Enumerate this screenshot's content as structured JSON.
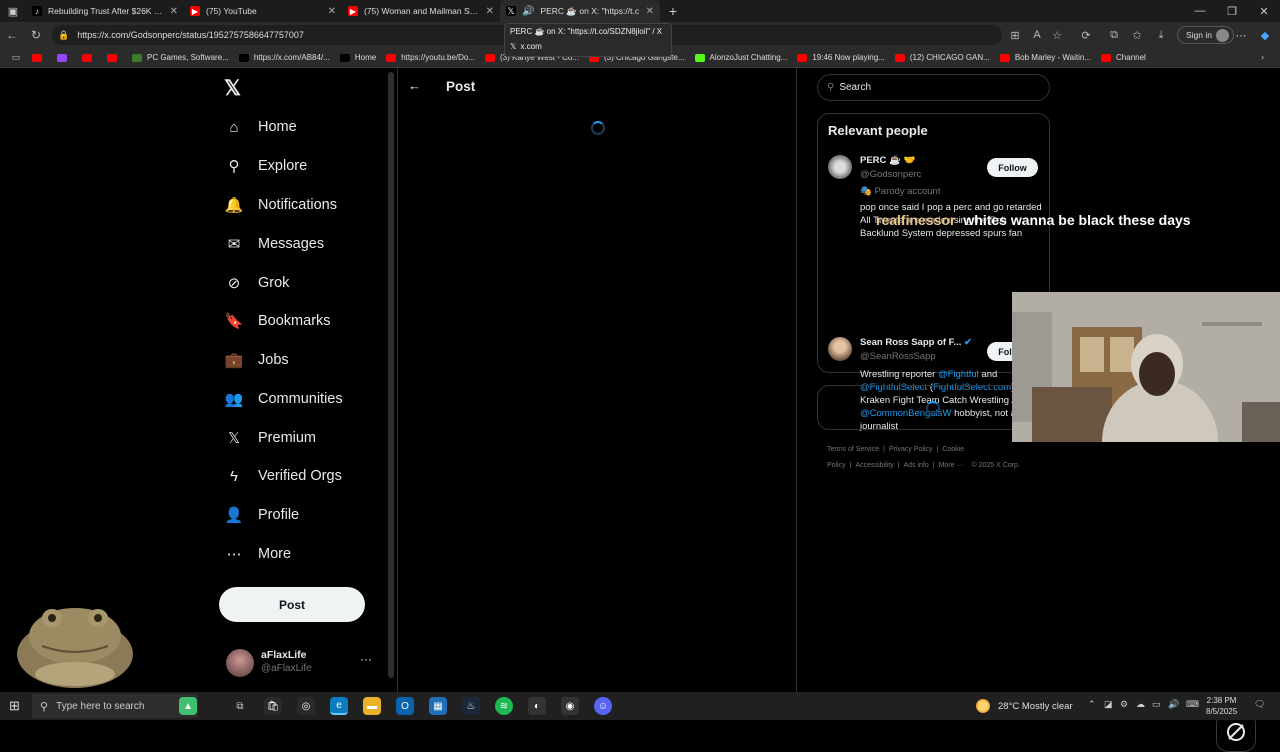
{
  "browser": {
    "tabs": [
      {
        "title": "Rebuilding Trust After $26K Poké",
        "favicon": "tiktok-icon",
        "color": "#000000"
      },
      {
        "title": "(75) YouTube",
        "favicon": "youtube-icon",
        "color": "#ff0000"
      },
      {
        "title": "(75) Woman and Mailman Share",
        "favicon": "youtube-icon",
        "color": "#ff0000"
      },
      {
        "title": "PERC ☕ on X: \"https://t.c",
        "favicon": "x-icon",
        "color": "#000000"
      }
    ],
    "tooltip": {
      "title": "PERC ☕ on X: \"https://t.co/SDZN8jloil\" / X",
      "domain": "x.com"
    },
    "url": "https://x.com/Godsonperc/status/1952757586647757007",
    "signin_label": "Sign in",
    "bookmarks": [
      {
        "label": "",
        "color": "#ff0000"
      },
      {
        "label": "",
        "color": "#9146ff"
      },
      {
        "label": "",
        "color": "#ff0000"
      },
      {
        "label": "",
        "color": "#ff0000"
      },
      {
        "label": "PC Games, Software...",
        "color": "#3a7d2c"
      },
      {
        "label": "https://x.com/AB84/...",
        "color": "#000000"
      },
      {
        "label": "Home",
        "color": "#000000"
      },
      {
        "label": "https://youtu.be/Do...",
        "color": "#ff0000"
      },
      {
        "label": "(3) Kanye West - Co...",
        "color": "#ff0000"
      },
      {
        "label": "(3) Chicago Gangste...",
        "color": "#ff0000"
      },
      {
        "label": "AlonzoJust Chatting...",
        "color": "#53fc18"
      },
      {
        "label": "19:46 Now playing...",
        "color": "#ff0000"
      },
      {
        "label": "(12) CHICAGO GAN...",
        "color": "#ff0000"
      },
      {
        "label": "Bob Marley - Waitin...",
        "color": "#ff0000"
      },
      {
        "label": "Channel",
        "color": "#ff0000"
      }
    ]
  },
  "nav": {
    "items": [
      {
        "label": "Home",
        "icon": "home-icon",
        "glyph": "⌂"
      },
      {
        "label": "Explore",
        "icon": "search-icon",
        "glyph": "⚲"
      },
      {
        "label": "Notifications",
        "icon": "bell-icon",
        "glyph": "🔔"
      },
      {
        "label": "Messages",
        "icon": "mail-icon",
        "glyph": "✉"
      },
      {
        "label": "Grok",
        "icon": "grok-icon",
        "glyph": "⊘"
      },
      {
        "label": "Bookmarks",
        "icon": "bookmark-icon",
        "glyph": "🔖"
      },
      {
        "label": "Jobs",
        "icon": "briefcase-icon",
        "glyph": "💼"
      },
      {
        "label": "Communities",
        "icon": "people-icon",
        "glyph": "👥"
      },
      {
        "label": "Premium",
        "icon": "x-logo-icon",
        "glyph": "𝕏"
      },
      {
        "label": "Verified Orgs",
        "icon": "lightning-icon",
        "glyph": "ϟ"
      },
      {
        "label": "Profile",
        "icon": "person-icon",
        "glyph": "👤"
      },
      {
        "label": "More",
        "icon": "more-circle-icon",
        "glyph": "⋯"
      }
    ],
    "post_label": "Post",
    "account": {
      "name": "aFlaxLife",
      "handle": "@aFlaxLife"
    }
  },
  "main": {
    "title": "Post"
  },
  "sidebar": {
    "search_placeholder": "Search",
    "relevant_title": "Relevant people",
    "people": [
      {
        "name": "PERC ☕ 🤝",
        "handle": "@Godsonperc",
        "tag": "🎭 Parody account",
        "bio": "pop once said I pop a perc and go retarded All Tweets are made using the Bob Backlund System depressed spurs fan",
        "follow": "Follow"
      },
      {
        "name": "Sean Ross Sapp of F...",
        "handle": "@SeanRossSapp",
        "bio_parts": [
          "Wrestling reporter ",
          "@Fightful",
          " and ",
          "@FightfulSelect",
          " (",
          "FightfulSelect.com",
          ") Kraken Fight Team Catch Wrestling Alum • ",
          "@CommonBengalsW",
          " hobbyist, not a journalist"
        ],
        "follow": "Follow"
      }
    ],
    "footer": [
      "Terms of Service",
      "|",
      "Privacy Policy",
      "|",
      "Cookie Policy",
      "|",
      "Accessibility",
      "|",
      "Ads info",
      "|",
      "More ···",
      "© 2025 X Corp."
    ]
  },
  "overlay": {
    "user": "realfinessor",
    "message": "whites wanna be black these days"
  },
  "taskbar": {
    "search_placeholder": "Type here to search",
    "weather": "28°C  Mostly clear",
    "time": "2:38 PM",
    "date": "8/5/2025"
  }
}
